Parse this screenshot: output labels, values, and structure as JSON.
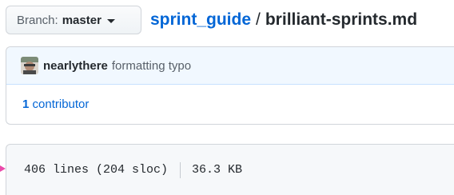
{
  "branch": {
    "prefix": "Branch:",
    "name": "master"
  },
  "breadcrumb": {
    "repo": "sprint_guide",
    "separator": "/",
    "file": "brilliant-sprints.md"
  },
  "commit": {
    "author": "nearlythere",
    "message": "formatting typo",
    "contributors_count": "1",
    "contributors_label": "contributor"
  },
  "file_info": {
    "lines": "406 lines (204 sloc)",
    "size": "36.3 KB"
  },
  "colors": {
    "link": "#0366d6",
    "commit_header_bg": "#f1f8ff",
    "file_header_bg": "#f6f8fa",
    "marker": "#ea4aaa"
  }
}
